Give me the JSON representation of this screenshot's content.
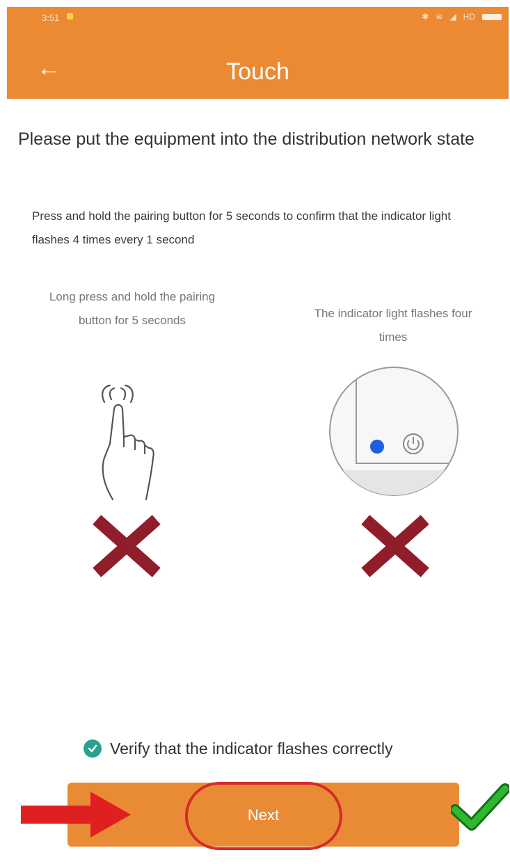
{
  "status_bar": {
    "time": "3:51",
    "network": "HD"
  },
  "header": {
    "back_icon": "arrow-left-icon",
    "title": "Touch",
    "color": "#ec8a34"
  },
  "headline": "Please put the equipment into the distribution network state",
  "instruction": "Press and hold the pairing button for 5 seconds to confirm that the indicator light flashes 4 times every 1 second",
  "steps": [
    {
      "caption": "Long press and hold the pairing button for 5 seconds",
      "icon": "hand-press-icon"
    },
    {
      "caption": "The indicator light flashes four times",
      "icon": "indicator-light-icon"
    }
  ],
  "verify": {
    "label": "Verify that the indicator flashes correctly",
    "checked": true,
    "color": "#2aa190"
  },
  "next_button": {
    "label": "Next",
    "color": "#e98b35"
  }
}
